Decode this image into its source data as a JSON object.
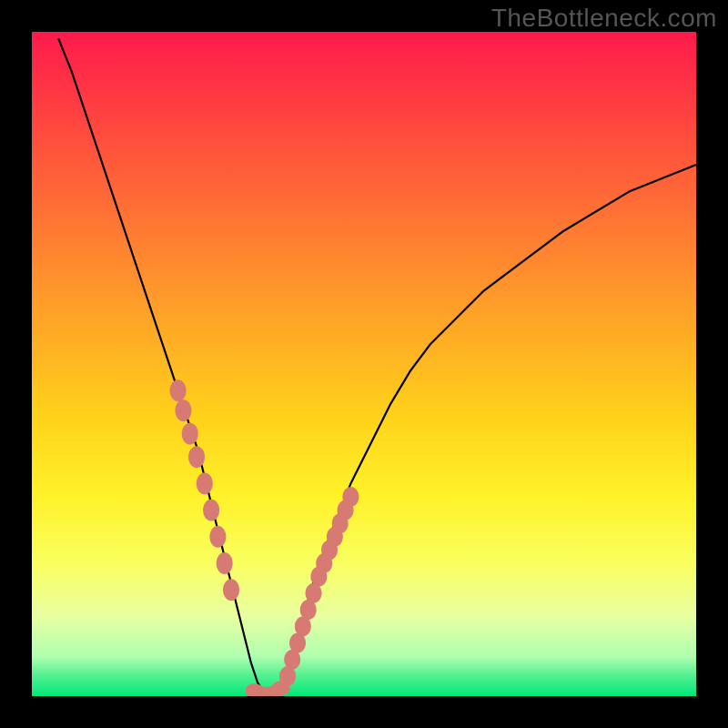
{
  "watermark": "TheBottleneck.com",
  "chart_data": {
    "type": "line",
    "x_range": [
      0,
      100
    ],
    "y_range": [
      0,
      100
    ],
    "curve": {
      "x": [
        4,
        6,
        8,
        10,
        12,
        14,
        16,
        18,
        20,
        22,
        24,
        25,
        26,
        27,
        28,
        29,
        30,
        31,
        32,
        33,
        34,
        35,
        36,
        37,
        38,
        39,
        40,
        42,
        44,
        46,
        48,
        50,
        52,
        54,
        57,
        60,
        64,
        68,
        72,
        76,
        80,
        85,
        90,
        95,
        100
      ],
      "y": [
        99,
        94,
        88,
        82,
        76,
        70,
        64,
        58,
        52,
        46,
        40,
        37,
        33,
        29,
        25,
        21,
        17,
        13,
        9,
        5,
        2,
        0.5,
        0.2,
        0.5,
        2,
        5,
        9,
        16,
        22,
        27,
        32,
        36,
        40,
        44,
        49,
        53,
        57,
        61,
        64,
        67,
        70,
        73,
        76,
        78,
        80
      ]
    },
    "beads_left": {
      "x": [
        22.0,
        22.8,
        23.8,
        24.8,
        26.0,
        27.0,
        28.0,
        29.0,
        30.0
      ],
      "y": [
        46.0,
        43.0,
        39.5,
        36.0,
        32.0,
        28.0,
        24.0,
        20.0,
        16.0
      ]
    },
    "beads_right": {
      "x": [
        38.5,
        39.2,
        40.0,
        40.8,
        41.6,
        42.4,
        43.2,
        44.0,
        44.8,
        45.6,
        46.4,
        47.2,
        48.0
      ],
      "y": [
        3.0,
        5.5,
        8.0,
        10.5,
        13.0,
        15.5,
        18.0,
        20.0,
        22.0,
        24.0,
        26.0,
        28.0,
        30.0
      ]
    },
    "beads_bottom": {
      "x": [
        33.5,
        34.5,
        35.5,
        36.5,
        37.5
      ],
      "y": [
        0.8,
        0.4,
        0.3,
        0.5,
        1.2
      ]
    },
    "gradient_stops": [
      {
        "offset": 0.0,
        "color": "#ff1a4b"
      },
      {
        "offset": 0.2,
        "color": "#ff5a3a"
      },
      {
        "offset": 0.4,
        "color": "#ff9a2a"
      },
      {
        "offset": 0.58,
        "color": "#ffd21a"
      },
      {
        "offset": 0.7,
        "color": "#fff22a"
      },
      {
        "offset": 0.8,
        "color": "#faff60"
      },
      {
        "offset": 0.88,
        "color": "#e8ffa0"
      },
      {
        "offset": 0.94,
        "color": "#b0ffb0"
      },
      {
        "offset": 0.97,
        "color": "#50f090"
      },
      {
        "offset": 1.0,
        "color": "#00e878"
      }
    ],
    "bead_color": "#d77a74"
  }
}
